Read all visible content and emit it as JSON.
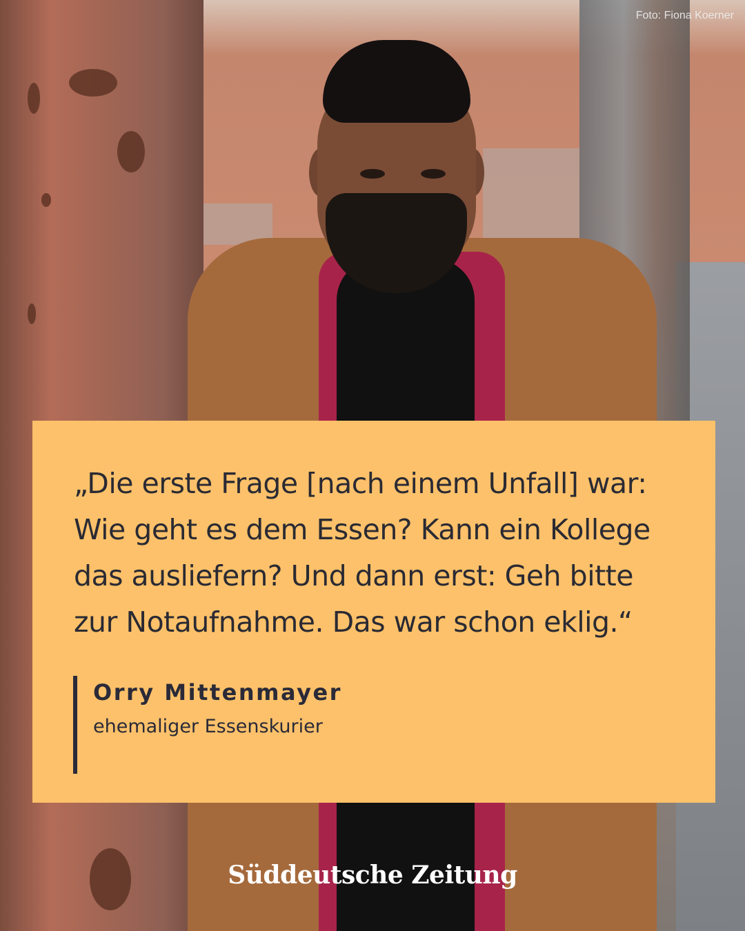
{
  "photo": {
    "credit": "Foto: Fiona Koerner"
  },
  "quote": {
    "text": "„Die erste Frage [nach einem Unfall] war: Wie geht es dem Essen? Kann ein Kollege das ausliefern? Und dann erst: Geh bitte zur Notaufnahme. Das war schon eklig.“",
    "author": "Orry Mittenmayer",
    "role": "ehemaliger Essenskurier",
    "box_color": "#fcc16a",
    "text_color": "#2a2a38"
  },
  "brand": {
    "logo_text": "Süddeutsche Zeitung",
    "logo_color": "#ffffff"
  }
}
